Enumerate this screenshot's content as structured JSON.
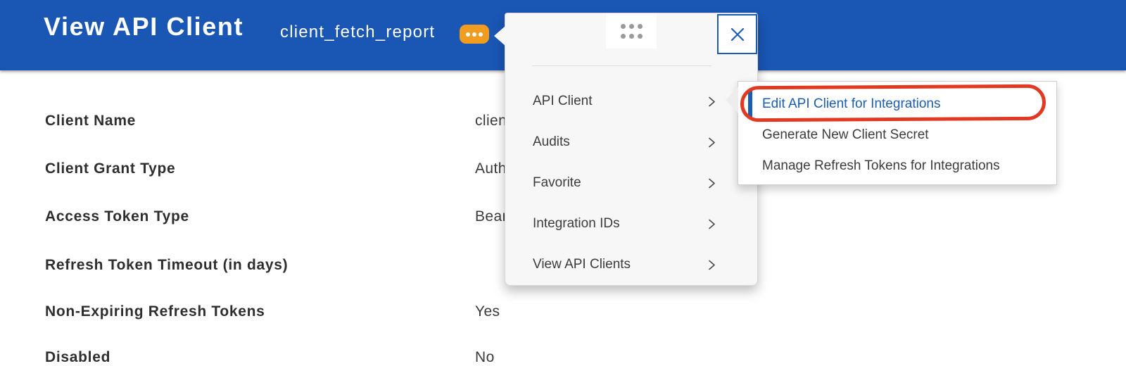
{
  "header": {
    "title": "View API Client",
    "subtitle": "client_fetch_report"
  },
  "form": {
    "rows": [
      {
        "label": "Client Name",
        "value": "client_fetch_report"
      },
      {
        "label": "Client Grant Type",
        "value": "Authorization Code Grant"
      },
      {
        "label": "Access Token Type",
        "value": "Bearer"
      },
      {
        "label": "Refresh Token Timeout (in days)",
        "value": ""
      },
      {
        "label": "Non-Expiring Refresh Tokens",
        "value": "Yes"
      },
      {
        "label": "Disabled",
        "value": "No"
      }
    ]
  },
  "menu": {
    "items": [
      {
        "label": "API Client"
      },
      {
        "label": "Audits"
      },
      {
        "label": "Favorite"
      },
      {
        "label": "Integration IDs"
      },
      {
        "label": "View API Clients"
      }
    ]
  },
  "submenu": {
    "items": [
      {
        "label": "Edit API Client for Integrations",
        "selected": true
      },
      {
        "label": "Generate New Client Secret",
        "selected": false
      },
      {
        "label": "Manage Refresh Tokens for Integrations",
        "selected": false
      }
    ]
  },
  "colors": {
    "header_bg": "#1a56b4",
    "accent_blue": "#1b5cb5",
    "related_actions_orange": "#f09c1e",
    "annotation_red": "#e23a22"
  }
}
